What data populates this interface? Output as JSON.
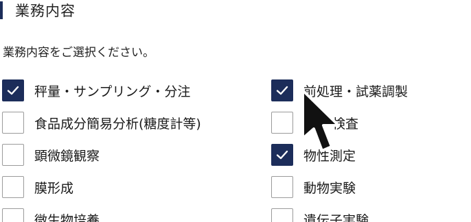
{
  "section": {
    "title": "業務内容"
  },
  "instruction": "業務内容をご選択ください。",
  "colors": {
    "accent": "#1c2d5a"
  },
  "options": [
    {
      "label": "秤量・サンプリング・分注",
      "checked": true
    },
    {
      "label": "前処理・試薬調製",
      "checked": true
    },
    {
      "label": "食品成分簡易分析(糖度計等)",
      "checked": false
    },
    {
      "label": "検査",
      "checked": false
    },
    {
      "label": "顕微鏡観察",
      "checked": false
    },
    {
      "label": "物性測定",
      "checked": true
    },
    {
      "label": "膜形成",
      "checked": false
    },
    {
      "label": "動物実験",
      "checked": false
    },
    {
      "label": "微生物培養",
      "checked": false
    },
    {
      "label": "遺伝子実験",
      "checked": false
    }
  ],
  "cursor": {
    "icon": "arrow-cursor-icon"
  }
}
